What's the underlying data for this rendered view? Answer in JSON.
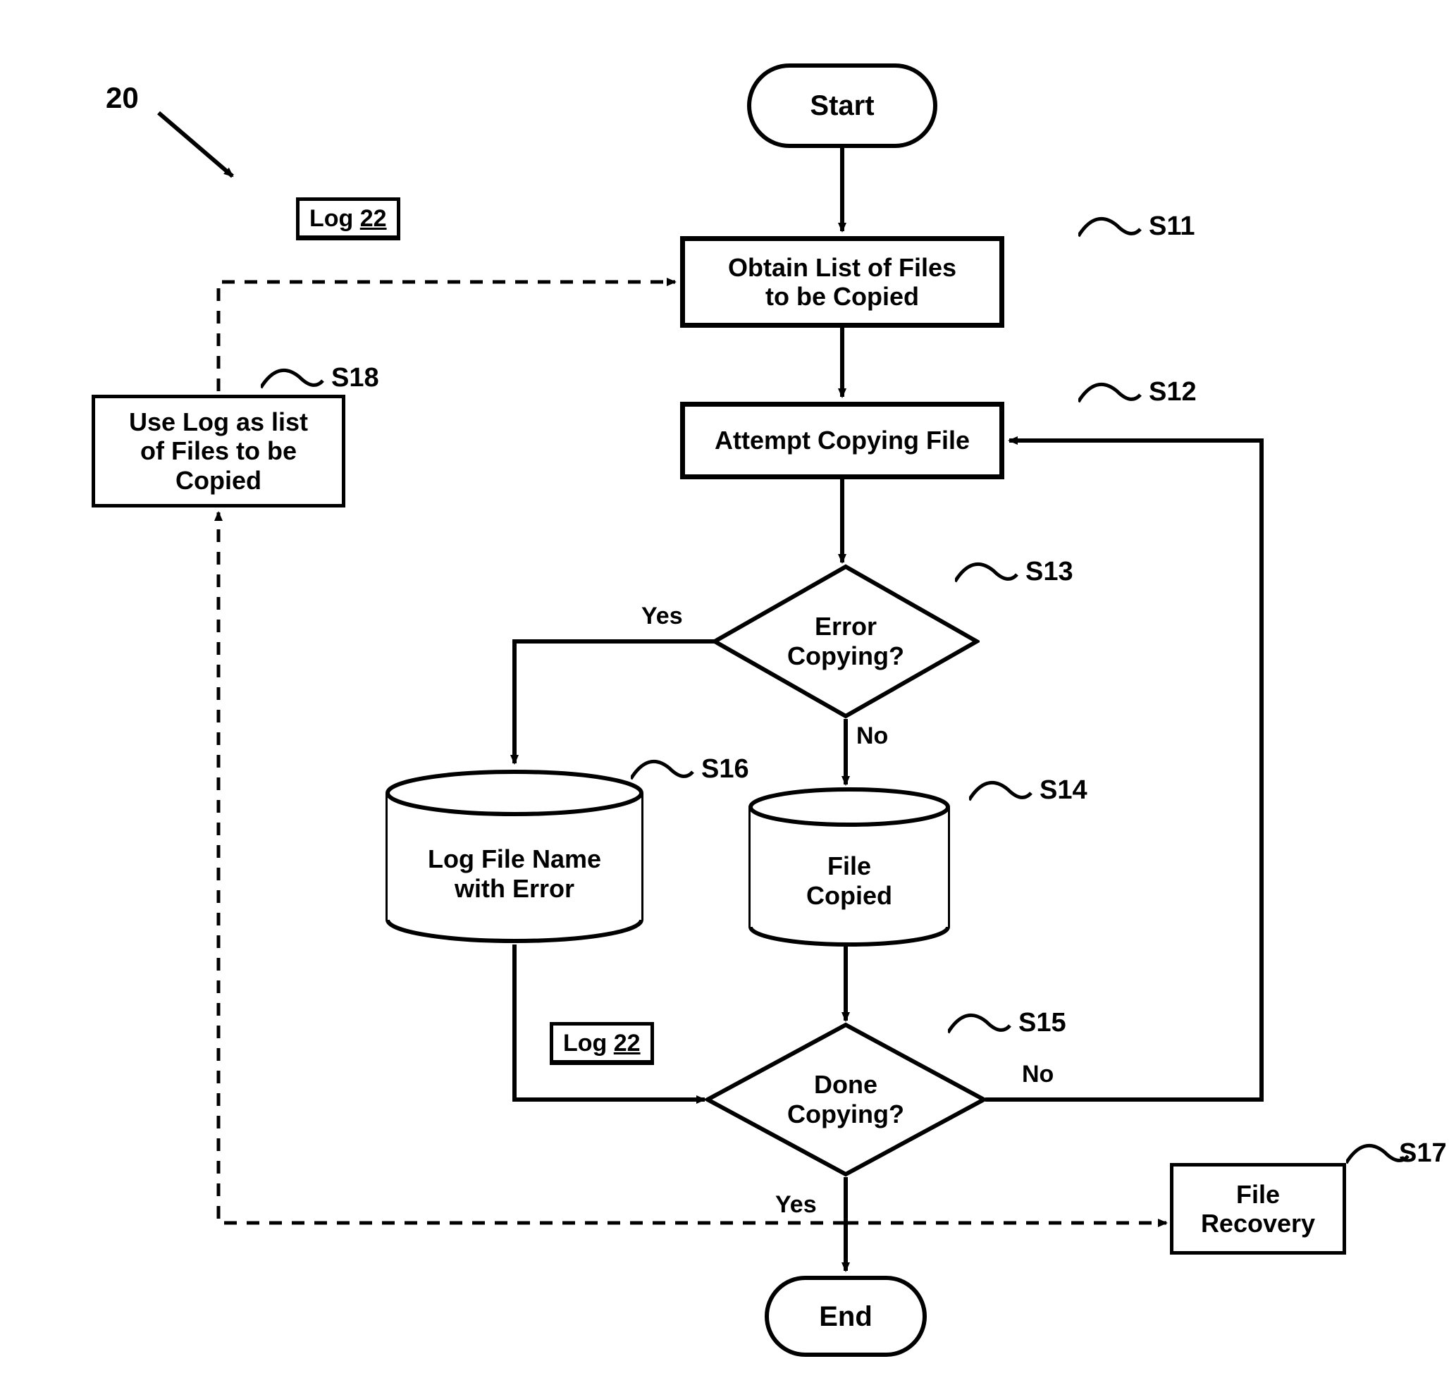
{
  "figure_ref": "20",
  "terminators": {
    "start": "Start",
    "end": "End"
  },
  "processes": {
    "s11": "Obtain List of Files\nto be Copied",
    "s12": "Attempt Copying File",
    "s17": "File\nRecovery",
    "s18": "Use Log as list\nof Files to be\nCopied"
  },
  "decisions": {
    "s13": "Error\nCopying?",
    "s15": "Done\nCopying?"
  },
  "cylinders": {
    "s14": "File\nCopied",
    "s16": "Log File Name\nwith Error"
  },
  "step_labels": {
    "s11": "S11",
    "s12": "S12",
    "s13": "S13",
    "s14": "S14",
    "s15": "S15",
    "s16": "S16",
    "s17": "S17",
    "s18": "S18"
  },
  "edge_labels": {
    "s13_yes": "Yes",
    "s13_no": "No",
    "s15_yes": "Yes",
    "s15_no": "No"
  },
  "log_tag": {
    "prefix": "Log ",
    "num": "22"
  },
  "chart_data": {
    "type": "flowchart",
    "nodes": [
      {
        "id": "start",
        "kind": "terminator",
        "text": "Start"
      },
      {
        "id": "S11",
        "kind": "process",
        "text": "Obtain List of Files to be Copied"
      },
      {
        "id": "S12",
        "kind": "process",
        "text": "Attempt Copying File"
      },
      {
        "id": "S13",
        "kind": "decision",
        "text": "Error Copying?"
      },
      {
        "id": "S14",
        "kind": "data-store",
        "text": "File Copied"
      },
      {
        "id": "S15",
        "kind": "decision",
        "text": "Done Copying?"
      },
      {
        "id": "S16",
        "kind": "data-store",
        "text": "Log File Name with Error"
      },
      {
        "id": "S17",
        "kind": "process",
        "text": "File Recovery"
      },
      {
        "id": "S18",
        "kind": "process",
        "text": "Use Log as list of Files to be Copied"
      },
      {
        "id": "end",
        "kind": "terminator",
        "text": "End"
      }
    ],
    "edges": [
      {
        "from": "start",
        "to": "S11",
        "style": "solid"
      },
      {
        "from": "S11",
        "to": "S12",
        "style": "solid"
      },
      {
        "from": "S12",
        "to": "S13",
        "style": "solid"
      },
      {
        "from": "S13",
        "to": "S16",
        "label": "Yes",
        "style": "solid"
      },
      {
        "from": "S13",
        "to": "S14",
        "label": "No",
        "style": "solid"
      },
      {
        "from": "S14",
        "to": "S15",
        "style": "solid"
      },
      {
        "from": "S16",
        "to": "S15",
        "label": "Log 22",
        "style": "solid"
      },
      {
        "from": "S15",
        "to": "S12",
        "label": "No",
        "style": "solid"
      },
      {
        "from": "S15",
        "to": "end",
        "label": "Yes",
        "style": "solid"
      },
      {
        "from": "S15",
        "to": "S17",
        "label": "Yes",
        "style": "dashed"
      },
      {
        "from": "S15",
        "to": "S18",
        "label": "Yes",
        "style": "dashed"
      },
      {
        "from": "S18",
        "to": "S11",
        "label": "Log 22",
        "style": "dashed"
      }
    ]
  }
}
